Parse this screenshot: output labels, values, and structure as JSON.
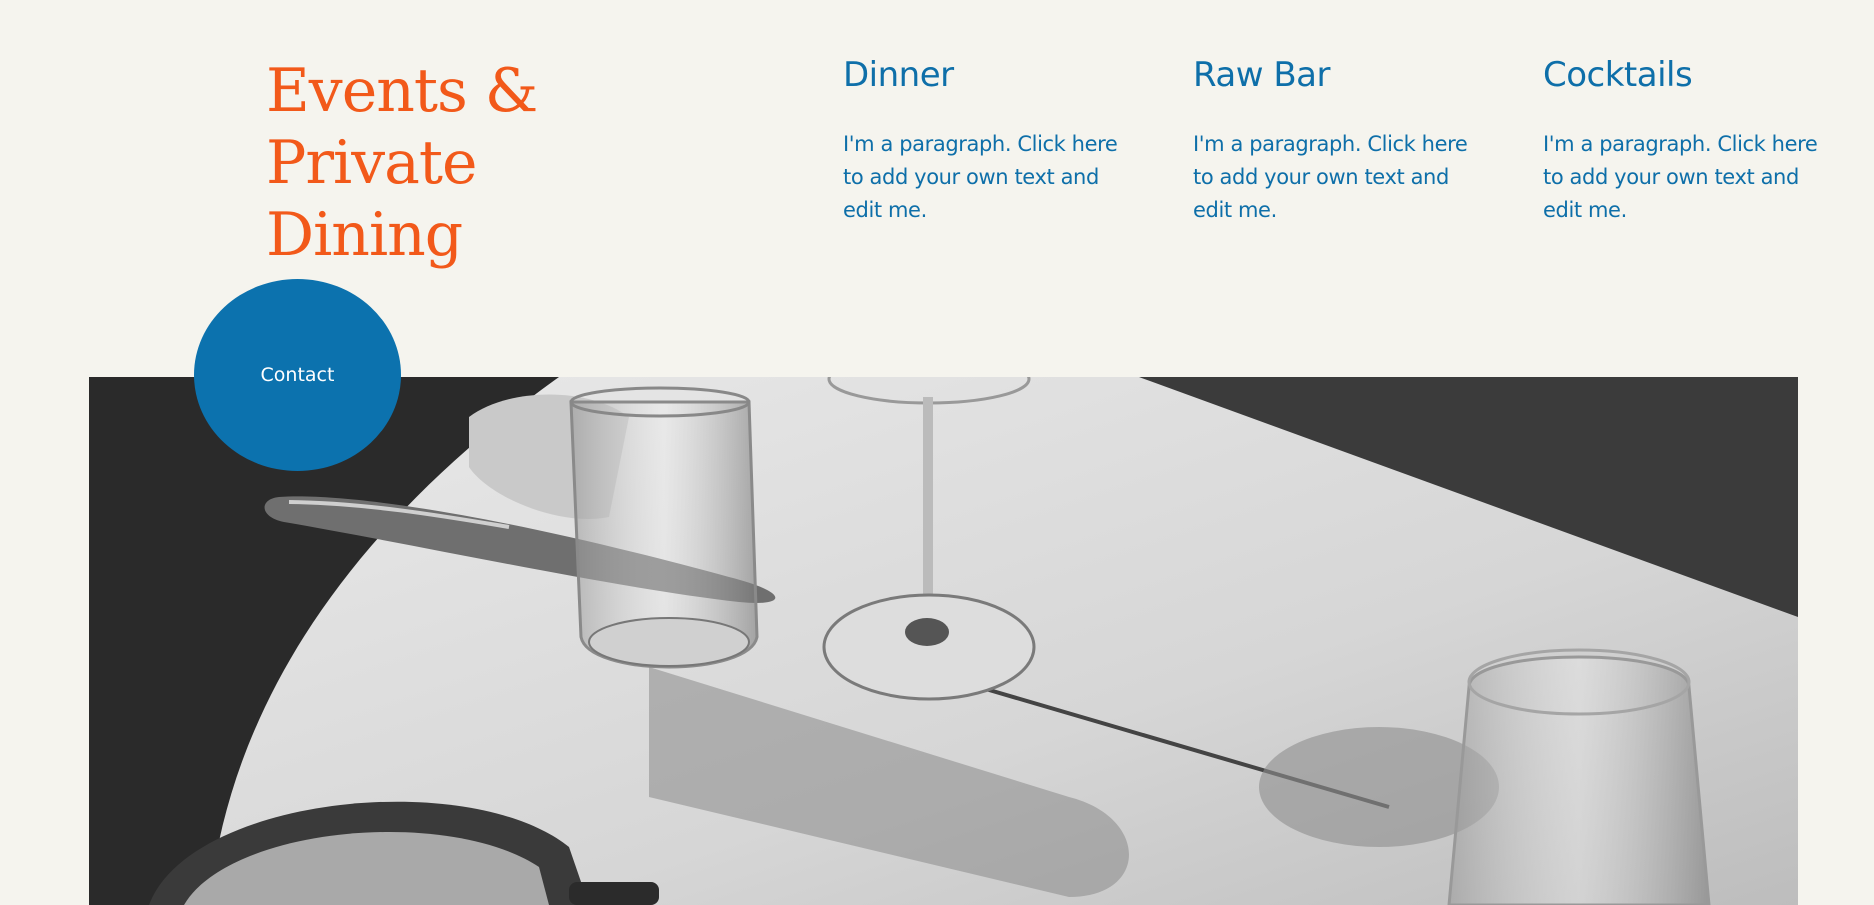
{
  "header": {
    "title": "Events & Private Dining"
  },
  "columns": [
    {
      "heading": "Dinner",
      "text": "I'm a paragraph. Click here to add your own text and edit me."
    },
    {
      "heading": "Raw Bar",
      "text": "I'm a paragraph. Click here to add your own text and edit me."
    },
    {
      "heading": "Cocktails",
      "text": "I'm a paragraph. Click here to add your own text and edit me."
    }
  ],
  "contact_button": {
    "label": "Contact"
  },
  "hero_image": {
    "subject": "black-and-white table setting with glasses and knife"
  },
  "colors": {
    "background": "#f5f4ee",
    "title_accent": "#f2591a",
    "text_blue": "#0e6fa9",
    "button_blue": "#0c72ae"
  }
}
